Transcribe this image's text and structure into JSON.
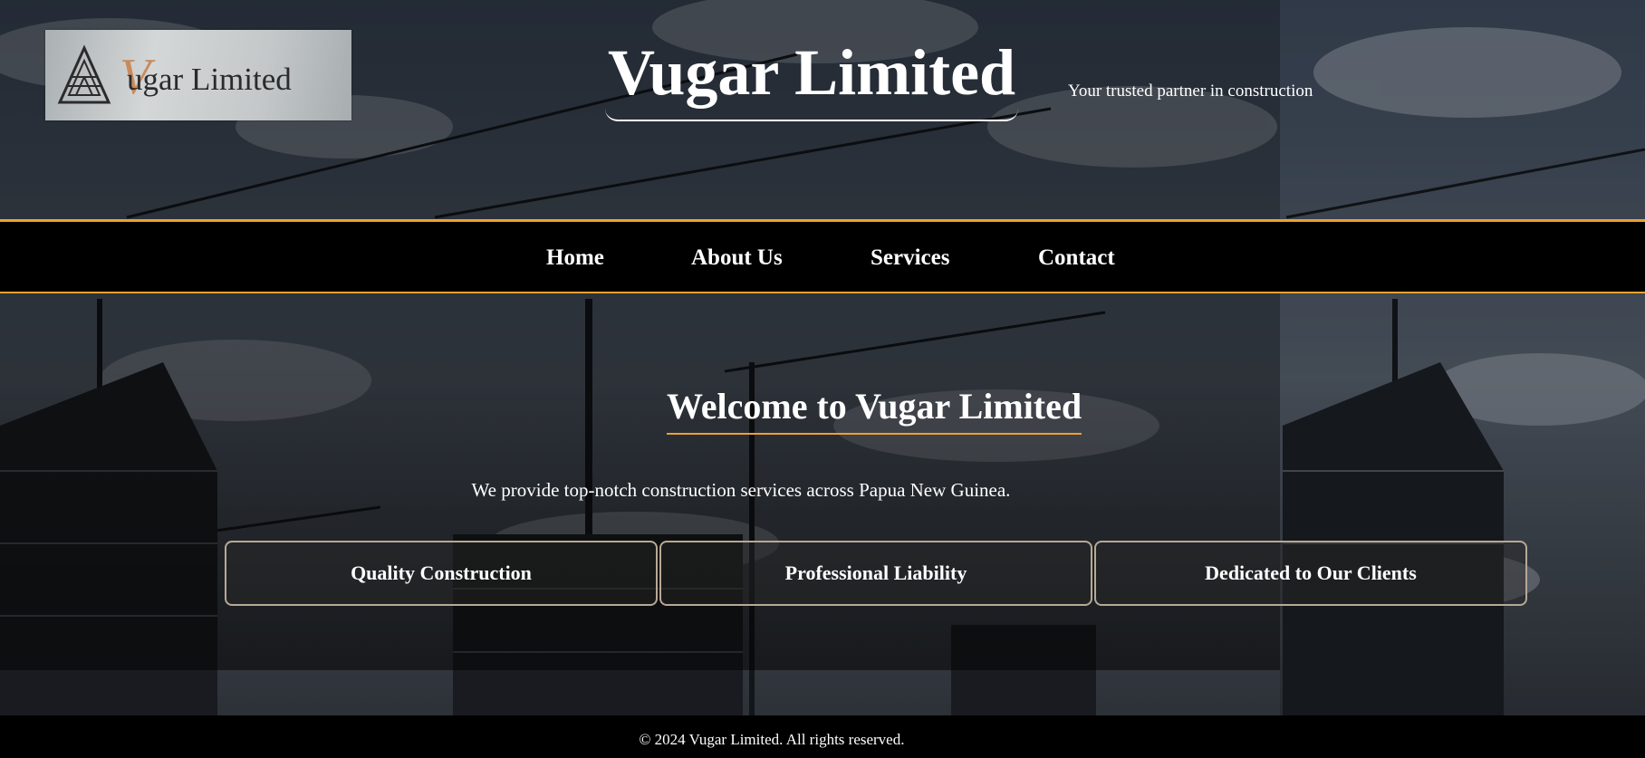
{
  "header": {
    "logo_text": "ugar Limited",
    "logo_initial": "V",
    "title": "Vugar Limited",
    "tagline": "Your trusted partner in construction"
  },
  "nav": {
    "items": [
      {
        "label": "Home"
      },
      {
        "label": "About Us"
      },
      {
        "label": "Services"
      },
      {
        "label": "Contact"
      }
    ]
  },
  "main": {
    "heading": "Welcome to Vugar Limited",
    "intro": "We provide top-notch construction services across Papua New Guinea.",
    "features": [
      {
        "label": "Quality Construction"
      },
      {
        "label": "Professional Liability"
      },
      {
        "label": "Dedicated to Our Clients"
      }
    ]
  },
  "footer": {
    "copyright": "© 2024 Vugar Limited. All rights reserved."
  },
  "colors": {
    "accent": "#f0a030",
    "nav_bg": "#000000",
    "card_border": "#b7a995"
  }
}
